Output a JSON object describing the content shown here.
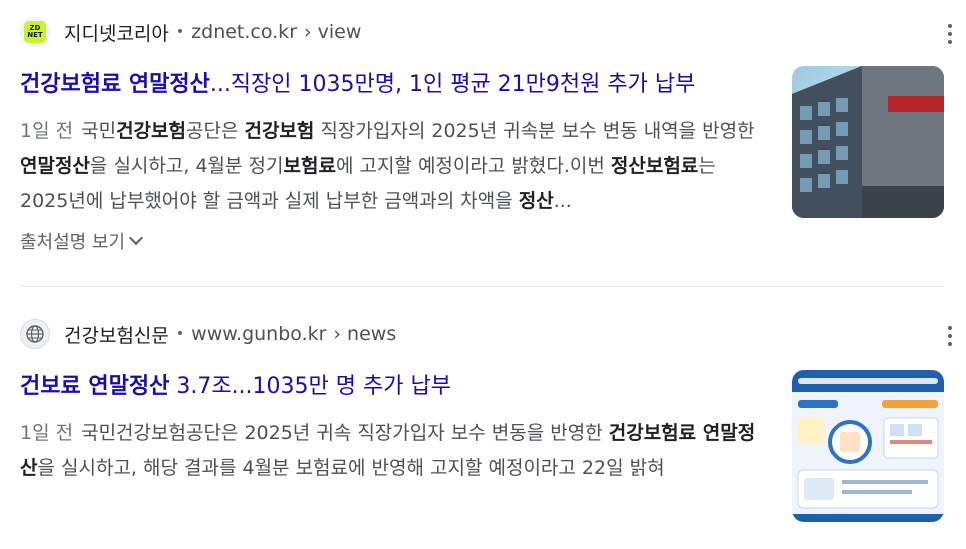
{
  "results": [
    {
      "favicon_text": "ZD NET",
      "site_name": "지디넷코리아",
      "url": "zdnet.co.kr",
      "url_path": "› view",
      "title_bold": "건강보험료 연말정산",
      "title_rest": "...직장인 1035만명, 1인 평균 21만9천원 추가 납부",
      "date": "1일 전",
      "snippet": {
        "s1": "국민",
        "b1": "건강보험",
        "s2": "공단은 ",
        "b2": "건강보험",
        "s3": " 직장가입자의 2025년 귀속분 보수 변동 내역을 반영한 ",
        "b3": "연말정산",
        "s4": "을 실시하고, 4월분 정기",
        "b4": "보험료",
        "s5": "에 고지할 예정이라고 밝혔다.이번 ",
        "b5": "정산보험료",
        "s6": "는 2025년에 납부했어야 할 금액과 실제 납부한 금액과의 차액을 ",
        "b6": "정산",
        "s7": "..."
      },
      "expand_label": "출처설명 보기"
    },
    {
      "site_name": "건강보험신문",
      "url": "www.gunbo.kr",
      "url_path": "› news",
      "title_bold": "건보료 연말정산",
      "title_rest": " 3.7조...1035만 명 추가 납부",
      "date": "1일 전",
      "snippet": {
        "s1": "국민건강보험공단은 2025년 귀속 직장가입자 보수 변동을 반영한 ",
        "b1": "건강보험료 연말정산",
        "s2": "을 실시하고, 해당 결과를 4월분 보험료에 반영해 고지할 예정이라고 22일 밝혀"
      }
    }
  ],
  "colors": {
    "title_link": "#1a0dab",
    "snippet_text": "#4d5156",
    "zdnet_brand": "#c6f432"
  },
  "icons": [
    "zdnet-favicon",
    "globe-icon",
    "more-vert-icon",
    "chevron-down-icon"
  ]
}
